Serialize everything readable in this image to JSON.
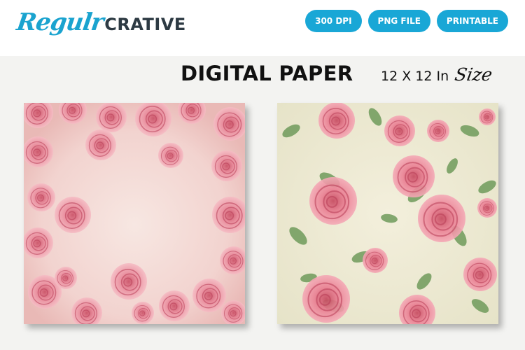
{
  "brand": {
    "script": "Regulr",
    "caps": "CRATIVE"
  },
  "badges": [
    "300 DPI",
    "PNG FILE",
    "PRINTABLE"
  ],
  "heading": {
    "title": "DIGITAL PAPER",
    "size_text": "12 X 12 In",
    "size_script": "Size"
  },
  "papers": [
    {
      "name": "rose-border-paper",
      "style": "pale pink wash with rose border"
    },
    {
      "name": "rose-leaf-pattern-paper",
      "style": "pink roses and green leaves on cream"
    }
  ],
  "colors": {
    "accent": "#19a7d6",
    "logo_script": "#1aa3cf",
    "logo_caps": "#2d3a43",
    "rose": "#e8899a",
    "leaf": "#6f9a5a"
  }
}
